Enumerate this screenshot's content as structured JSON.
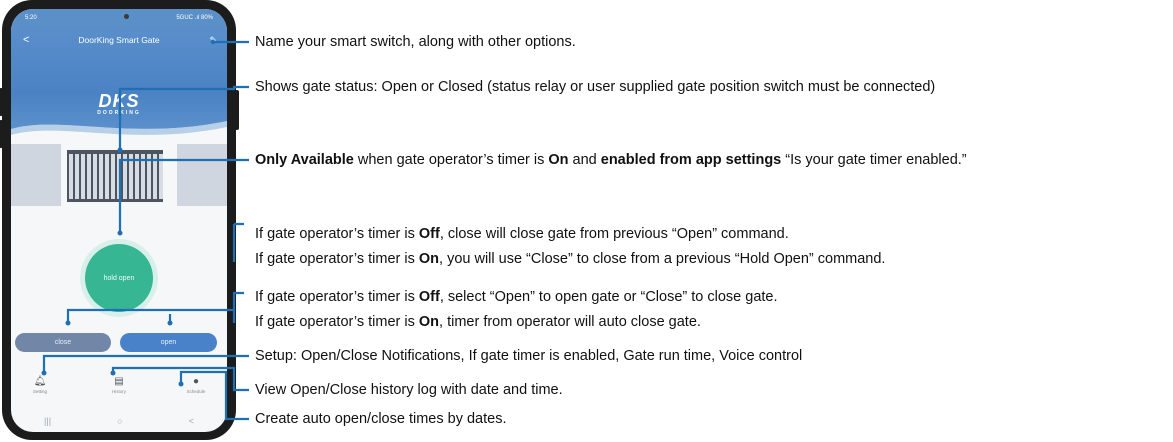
{
  "phone": {
    "status_left": "5:20",
    "status_right": "5GUC .ıl 80%",
    "title": "DoorKing Smart Gate",
    "logo": "DKS",
    "logo_sub": "DOORKING",
    "hold_open_label": "hold open",
    "close_label": "close",
    "open_label": "open",
    "tabs": [
      {
        "label": "Setting",
        "icon": "bell-icon"
      },
      {
        "label": "History",
        "icon": "clipboard-icon"
      },
      {
        "label": "Schedule",
        "icon": "clock-icon"
      }
    ],
    "nav": {
      "recents": "|||",
      "home": "○",
      "back": "<"
    }
  },
  "callouts": {
    "name": "Name your smart switch, along with other options.",
    "status": "Shows gate status: Open or Closed (status relay or user supplied gate position switch must be connected)",
    "hold": {
      "b1": "Only Available",
      "t1": " when gate operator’s timer is ",
      "b2": "On",
      "t2": " and ",
      "b3": "enabled from app settings",
      "t3": " “Is your gate timer enabled.”"
    },
    "close_off": {
      "t1": "If gate operator’s timer is ",
      "b1": "Off",
      "t2": ", close will close gate from previous “Open” command."
    },
    "close_on": {
      "t1": "If gate operator’s timer is ",
      "b1": "On",
      "t2": ", you will use “Close” to close from a previous “Hold Open” command."
    },
    "open_off": {
      "t1": "If gate operator’s timer is ",
      "b1": "Off",
      "t2": ", select “Open” to open gate or “Close” to close gate."
    },
    "open_on": {
      "t1": "If gate operator’s timer is ",
      "b1": "On",
      "t2": ", timer from operator will auto close gate."
    },
    "setup": "Setup: Open/Close Notifications, If gate timer is enabled, Gate run time, Voice control",
    "history": "View Open/Close history log with date and time.",
    "schedule": "Create auto open/close times by dates."
  },
  "colors": {
    "callout_line": "#1e6fb4",
    "header_blue": "#4a82c4",
    "hold_green": "#36b693"
  }
}
